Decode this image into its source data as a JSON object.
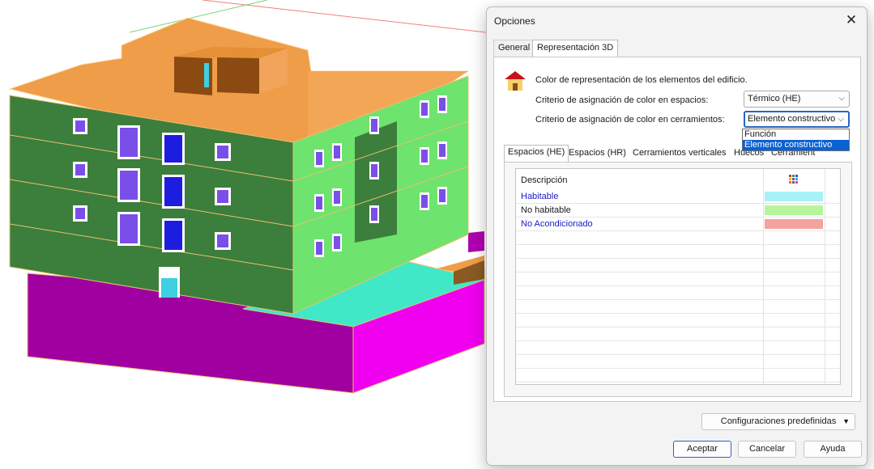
{
  "dialog": {
    "title": "Opciones",
    "close_glyph": "✕",
    "tabs": [
      {
        "label": "General"
      },
      {
        "label": "Representación 3D"
      }
    ],
    "section_title": "Color de representación de los elementos del edificio.",
    "spaces_criterion_label": "Criterio de asignación de color en espacios:",
    "spaces_criterion_value": "Térmico (HE)",
    "enclosures_criterion_label": "Criterio de asignación de color en cerramientos:",
    "enclosures_criterion_value": "Elemento constructivo",
    "enclosures_options": [
      "Función",
      "Elemento constructivo"
    ],
    "subtabs": [
      "Espacios (HE)",
      "Espacios (HR)",
      "Cerramientos verticales",
      "Huecos",
      "Cerramient"
    ],
    "grid": {
      "header": "Descripción",
      "rows": [
        {
          "label": "Habitable",
          "color": "#a8f1f7",
          "text_color": "#1a1ac8"
        },
        {
          "label": "No habitable",
          "color": "#b6f59a",
          "text_color": "#1a1a1a"
        },
        {
          "label": "No Acondicionado",
          "color": "#f2a3a0",
          "text_color": "#1a1ac8"
        }
      ]
    },
    "presets_button": "Configuraciones predefinidas",
    "ok_button": "Aceptar",
    "cancel_button": "Cancelar",
    "help_button": "Ayuda"
  },
  "colors": {
    "accent": "#2a65c4",
    "wall_dark_green": "#3c7e3c",
    "wall_light_green": "#6ee36e",
    "roof_orange": "#ef9d48",
    "base_magenta": "#a000a0",
    "cyan_surface": "#3ee0c4"
  }
}
